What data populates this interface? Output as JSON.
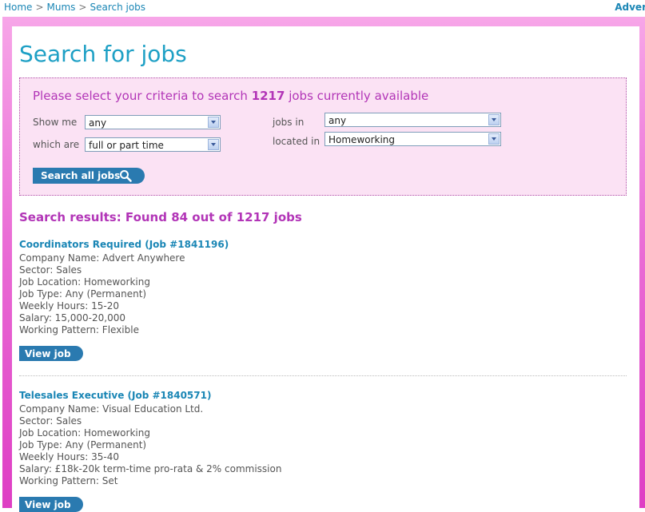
{
  "breadcrumb": {
    "items": [
      "Home",
      "Mums",
      "Search jobs"
    ],
    "separator": ">"
  },
  "advert_link": "Adver",
  "page_title": "Search for jobs",
  "criteria": {
    "intro_before": "Please select your criteria to search ",
    "count": "1217",
    "intro_after": " jobs currently available",
    "show_me_label": "Show me",
    "show_me_value": "any",
    "which_are_label": "which are",
    "which_are_value": "full or part time",
    "jobs_in_label": "jobs in",
    "jobs_in_value": "any",
    "located_in_label": "located in",
    "located_in_value": "Homeworking",
    "search_button": "Search all jobs"
  },
  "results_title": "Search results: Found 84 out of 1217 jobs",
  "jobs": [
    {
      "title": "Coordinators Required (Job #1841196)",
      "lines": [
        "Company Name: Advert Anywhere",
        "Sector: Sales",
        "Job Location: Homeworking",
        "Job Type: Any (Permanent)",
        "Weekly Hours: 15-20",
        "Salary: 15,000-20,000",
        "Working Pattern: Flexible"
      ],
      "button": "View job"
    },
    {
      "title": "Telesales Executive (Job #1840571)",
      "lines": [
        "Company Name: Visual Education Ltd.",
        "Sector: Sales",
        "Job Location: Homeworking",
        "Job Type: Any (Permanent)",
        "Weekly Hours: 35-40",
        "Salary: £18k-20k term-time pro-rata & 2% commission",
        "Working Pattern: Set"
      ],
      "button": "View job"
    }
  ],
  "colors": {
    "accent_blue": "#1ea0c5",
    "accent_magenta": "#b235b7",
    "button_blue": "#2a7ab0",
    "criteria_bg": "#fbe2f4"
  },
  "icons": {
    "search": "magnifier-icon",
    "dropdown": "chevron-down-icon"
  }
}
